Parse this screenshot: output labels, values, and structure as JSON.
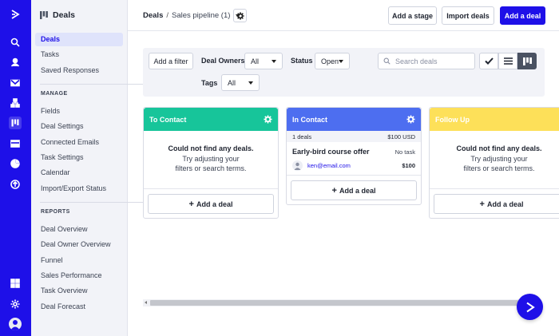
{
  "app": {
    "brand_color": "#1e10e8",
    "rail_icons": [
      "logo-icon",
      "search-icon",
      "contacts-icon",
      "email-icon",
      "automation-icon",
      "deals-icon",
      "campaigns-icon",
      "reports-icon",
      "conversations-icon",
      "apps-icon",
      "settings-icon",
      "avatar"
    ]
  },
  "sidebar": {
    "title": "Deals",
    "items": [
      {
        "label": "Deals",
        "active": true
      },
      {
        "label": "Tasks"
      },
      {
        "label": "Saved Responses"
      }
    ],
    "manage_heading": "MANAGE",
    "manage_items": [
      {
        "label": "Fields"
      },
      {
        "label": "Deal Settings"
      },
      {
        "label": "Connected Emails"
      },
      {
        "label": "Task Settings"
      },
      {
        "label": "Calendar"
      },
      {
        "label": "Import/Export Status"
      }
    ],
    "reports_heading": "REPORTS",
    "reports_items": [
      {
        "label": "Deal Overview"
      },
      {
        "label": "Deal Owner Overview"
      },
      {
        "label": "Funnel"
      },
      {
        "label": "Sales Performance"
      },
      {
        "label": "Task Overview"
      },
      {
        "label": "Deal Forecast"
      }
    ]
  },
  "header": {
    "breadcrumb_root": "Deals",
    "breadcrumb_sep": "/",
    "pipeline": "Sales pipeline (1)",
    "add_stage": "Add a stage",
    "import_deals": "Import deals",
    "add_deal": "Add a deal"
  },
  "filters": {
    "add_filter": "Add a filter",
    "deal_owners_label": "Deal Owners",
    "deal_owners_value": "All",
    "status_label": "Status",
    "status_value": "Open",
    "tags_label": "Tags",
    "tags_value": "All",
    "search_placeholder": "Search deals",
    "views": [
      "check-icon",
      "list-view-icon",
      "board-view-icon"
    ],
    "active_view": "board-view-icon"
  },
  "stages": [
    {
      "name": "To Contact",
      "color": "#17c59a",
      "empty_title": "Could not find any deals.",
      "empty_line1": "Try adjusting your",
      "empty_line2": "filters or search terms.",
      "add_label": "Add a deal"
    },
    {
      "name": "In Contact",
      "color": "#4d6ef0",
      "summary_count": "1 deals",
      "summary_total": "$100 USD",
      "deal": {
        "title": "Early-bird course offer",
        "task": "No task",
        "email": "ken@email.com",
        "amount": "$100"
      },
      "add_label": "Add a deal"
    },
    {
      "name": "Follow Up",
      "color": "#fde059",
      "empty_title": "Could not find any deals.",
      "empty_line1": "Try adjusting your",
      "empty_line2": "filters or search terms.",
      "add_label": "Add a deal"
    }
  ]
}
